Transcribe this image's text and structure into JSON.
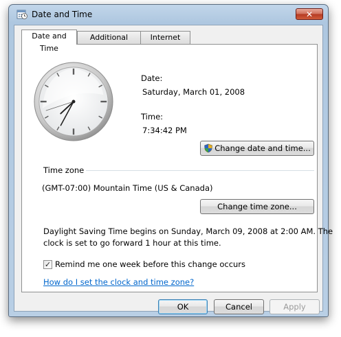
{
  "window": {
    "title": "Date and Time",
    "close_label": "✕"
  },
  "tabs": [
    {
      "label": "Date and Time",
      "active": true
    },
    {
      "label": "Additional Clocks",
      "active": false
    },
    {
      "label": "Internet Time",
      "active": false
    }
  ],
  "datetime": {
    "date_label": "Date:",
    "date_value": "Saturday, March 01, 2008",
    "time_label": "Time:",
    "time_value": "7:34:42 PM",
    "change_button": "Change date and time..."
  },
  "clock": {
    "hour": 7,
    "minute": 34,
    "second": 42
  },
  "timezone": {
    "group_label": "Time zone",
    "value": "(GMT-07:00) Mountain Time (US & Canada)",
    "change_button": "Change time zone..."
  },
  "dst": {
    "line1": "Daylight Saving Time begins on Sunday, March 09, 2008 at 2:00 AM. The",
    "line2": "clock is set to go forward 1 hour at this time.",
    "remind_label": "Remind me one week before this change occurs",
    "remind_checked": true
  },
  "help_link": "How do I set the clock and time zone?",
  "buttons": {
    "ok": "OK",
    "cancel": "Cancel",
    "apply": "Apply"
  },
  "icons": {
    "title_icon": "clock-calendar-icon",
    "shield_icon": "uac-shield-icon",
    "close_icon": "close-icon"
  },
  "colors": {
    "link": "#0066cc",
    "close_button": "#c94a2e",
    "frame": "#b9cfe5"
  }
}
